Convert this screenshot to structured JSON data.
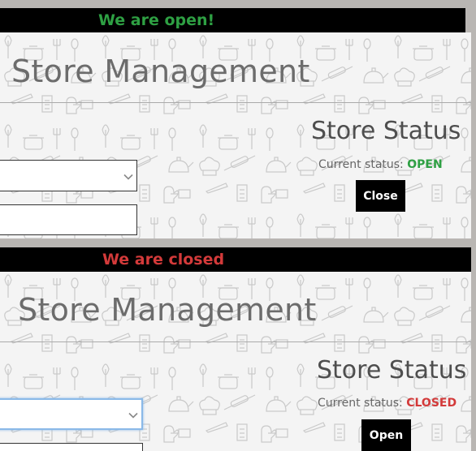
{
  "screens": [
    {
      "banner": "We are open!",
      "banner_color": "#2ea043",
      "title": "Store Management",
      "status_heading": "Store Status",
      "status_label": "Current status:",
      "status_value": "OPEN",
      "status_color": "#2ea043",
      "action_button": "Close"
    },
    {
      "banner": "We are closed",
      "banner_color": "#d33a3a",
      "title": "Store Management",
      "status_heading": "Store Status",
      "status_label": "Current status:",
      "status_value": "CLOSED",
      "status_color": "#d33a3a",
      "action_button": "Open"
    }
  ]
}
